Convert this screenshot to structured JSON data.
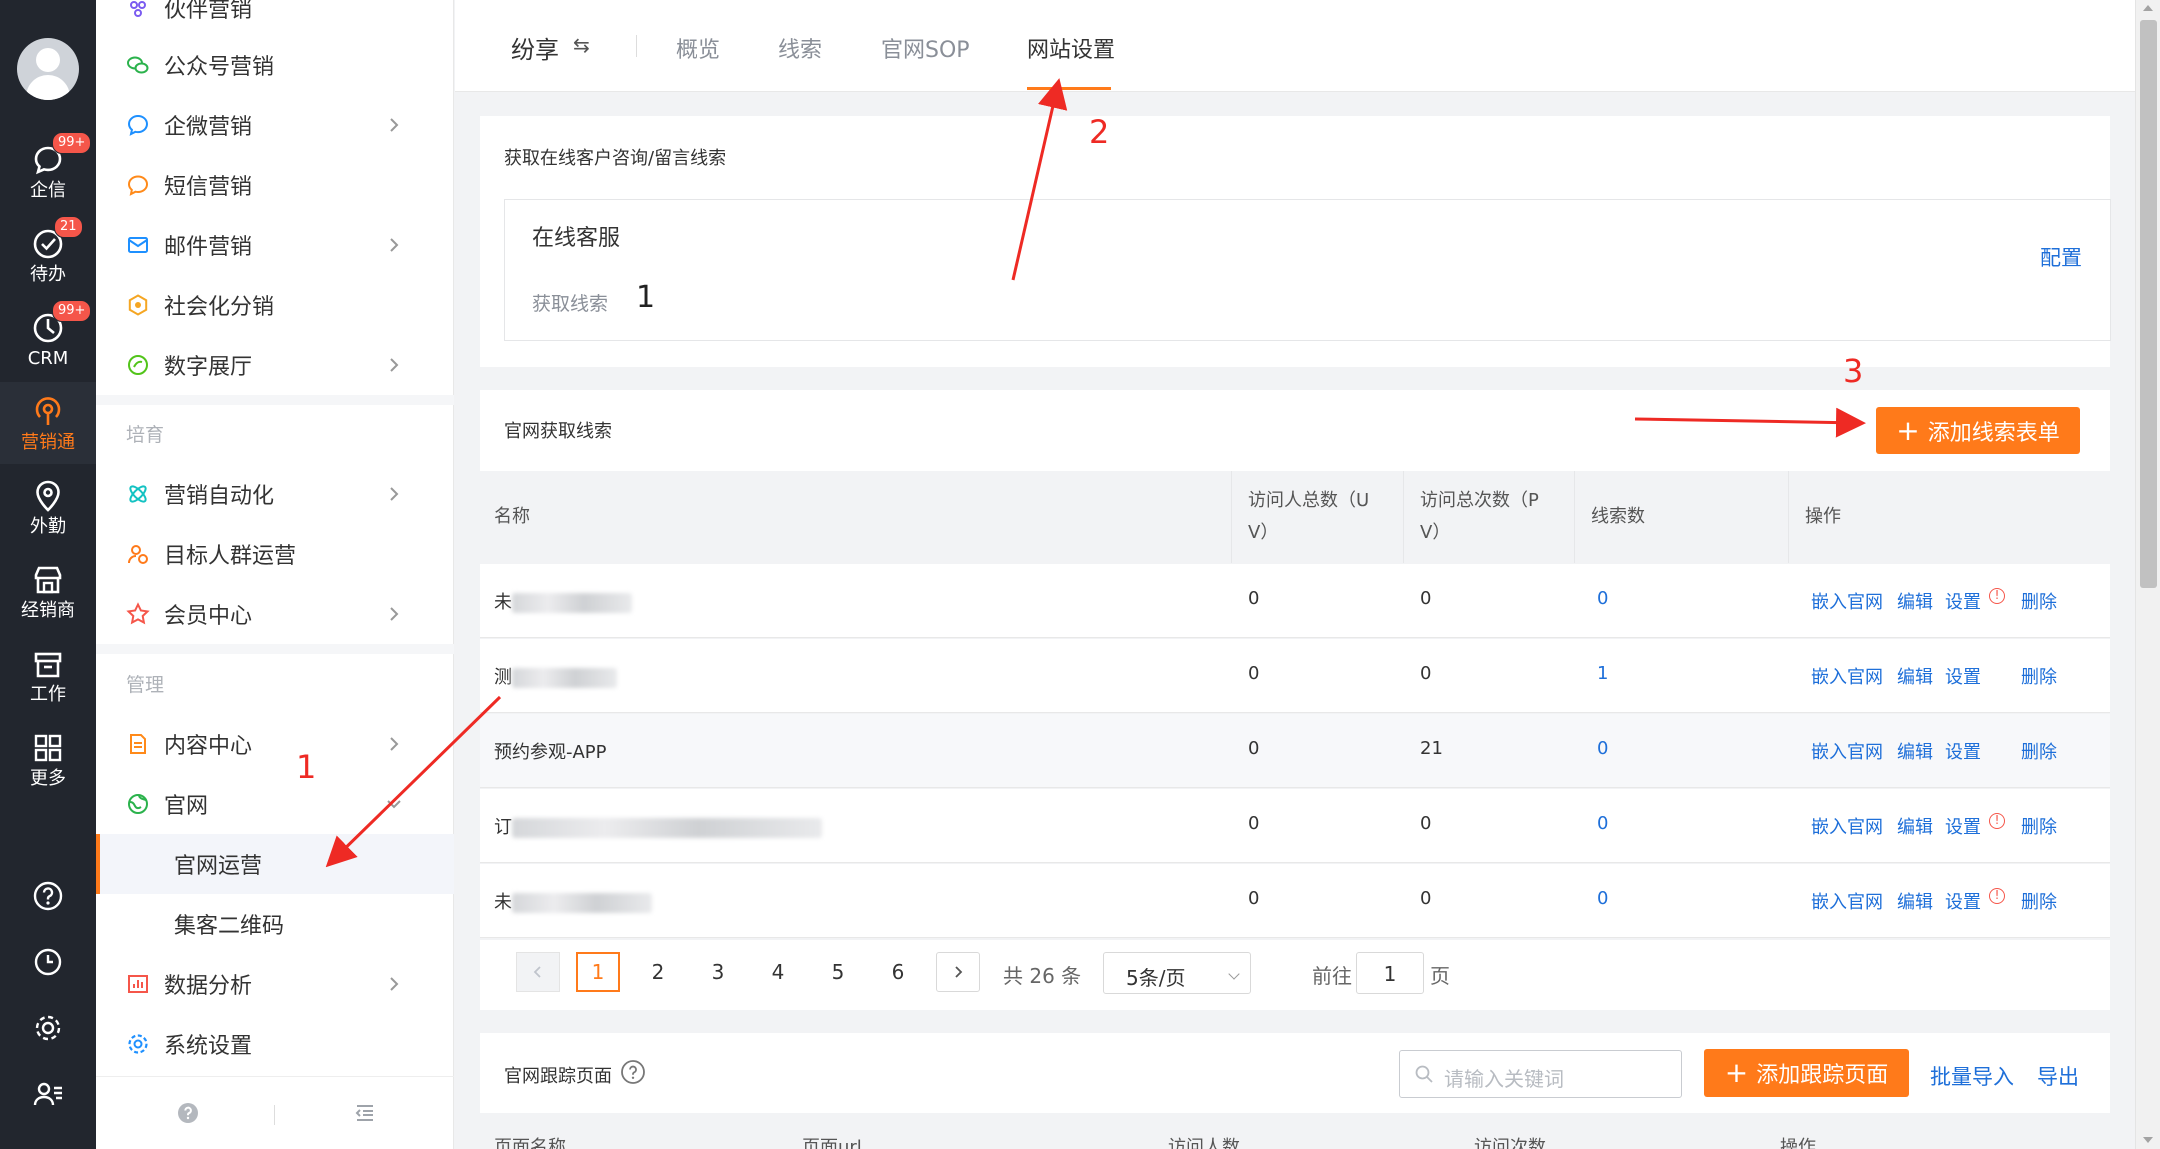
{
  "rail": {
    "items": [
      {
        "label": "企信",
        "badge": "99+"
      },
      {
        "label": "待办",
        "badge": "21"
      },
      {
        "label": "CRM",
        "badge": "99+"
      },
      {
        "label": "营销通"
      },
      {
        "label": "外勤"
      },
      {
        "label": "经销商"
      },
      {
        "label": "工作"
      },
      {
        "label": "更多"
      }
    ]
  },
  "menu": {
    "top_partial": "伙伴营销",
    "items": [
      {
        "label": "公众号营销"
      },
      {
        "label": "企微营销"
      },
      {
        "label": "短信营销"
      },
      {
        "label": "邮件营销"
      },
      {
        "label": "社会化分销"
      },
      {
        "label": "数字展厅"
      },
      {
        "label": "营销自动化"
      },
      {
        "label": "目标人群运营"
      },
      {
        "label": "会员中心"
      },
      {
        "label": "内容中心"
      },
      {
        "label": "官网"
      },
      {
        "label": "官网运营"
      },
      {
        "label": "集客二维码"
      },
      {
        "label": "数据分析"
      },
      {
        "label": "系统设置"
      }
    ],
    "sections": {
      "nurture": "培育",
      "manage": "管理"
    }
  },
  "topbar": {
    "brand": "纷享",
    "swap": "⇆",
    "tabs": [
      "概览",
      "线索",
      "官网SOP",
      "网站设置"
    ],
    "active_tab": "网站设置"
  },
  "online_service": {
    "title": "获取在线客户咨询/留言线索",
    "service_title": "在线客服",
    "fetch_label": "获取线索",
    "config_link": "配置"
  },
  "leads": {
    "title": "官网获取线索",
    "add_button": "添加线索表单",
    "columns": [
      "名称",
      "访问人总数（U V）",
      "访问总次数（P V）",
      "线索数",
      "操作"
    ],
    "col_uv": [
      "访问人总数（U",
      "V）"
    ],
    "col_pv": [
      "访问总次数（P",
      "V）"
    ],
    "rows": [
      {
        "name": "未",
        "uv": "0",
        "pv": "0",
        "leads": "0",
        "warn": true
      },
      {
        "name": "测",
        "uv": "0",
        "pv": "0",
        "leads": "1",
        "warn": false
      },
      {
        "name": "预约参观-APP",
        "uv": "0",
        "pv": "21",
        "leads": "0",
        "warn": false
      },
      {
        "name": "订",
        "uv": "0",
        "pv": "0",
        "leads": "0",
        "warn": true
      },
      {
        "name": "未",
        "uv": "0",
        "pv": "0",
        "leads": "0",
        "warn": true
      }
    ],
    "op_labels": {
      "embed": "嵌入官网",
      "edit": "编辑",
      "settings": "设置",
      "delete": "删除",
      "warn": "!"
    }
  },
  "pagination": {
    "pages": [
      "1",
      "2",
      "3",
      "4",
      "5",
      "6"
    ],
    "current": "1",
    "total": "共 26 条",
    "page_size": "5条/页",
    "goto_label": "前往",
    "goto_value": "1",
    "page_unit": "页"
  },
  "tracking": {
    "title": "官网跟踪页面",
    "help": "?",
    "search_placeholder": "请输入关键词",
    "add_button": "添加跟踪页面",
    "batch_import": "批量导入",
    "export": "导出",
    "columns": [
      "页面名称",
      "页面url",
      "访问人数",
      "访问次数",
      "操作"
    ]
  },
  "annotations": {
    "a1": "1",
    "a1b": "1",
    "a2": "2",
    "a3": "3"
  },
  "colors": {
    "accent": "#ff7a1a",
    "link": "#1e6fd9",
    "annotation": "#ee2a24",
    "rail": "#22262e"
  }
}
